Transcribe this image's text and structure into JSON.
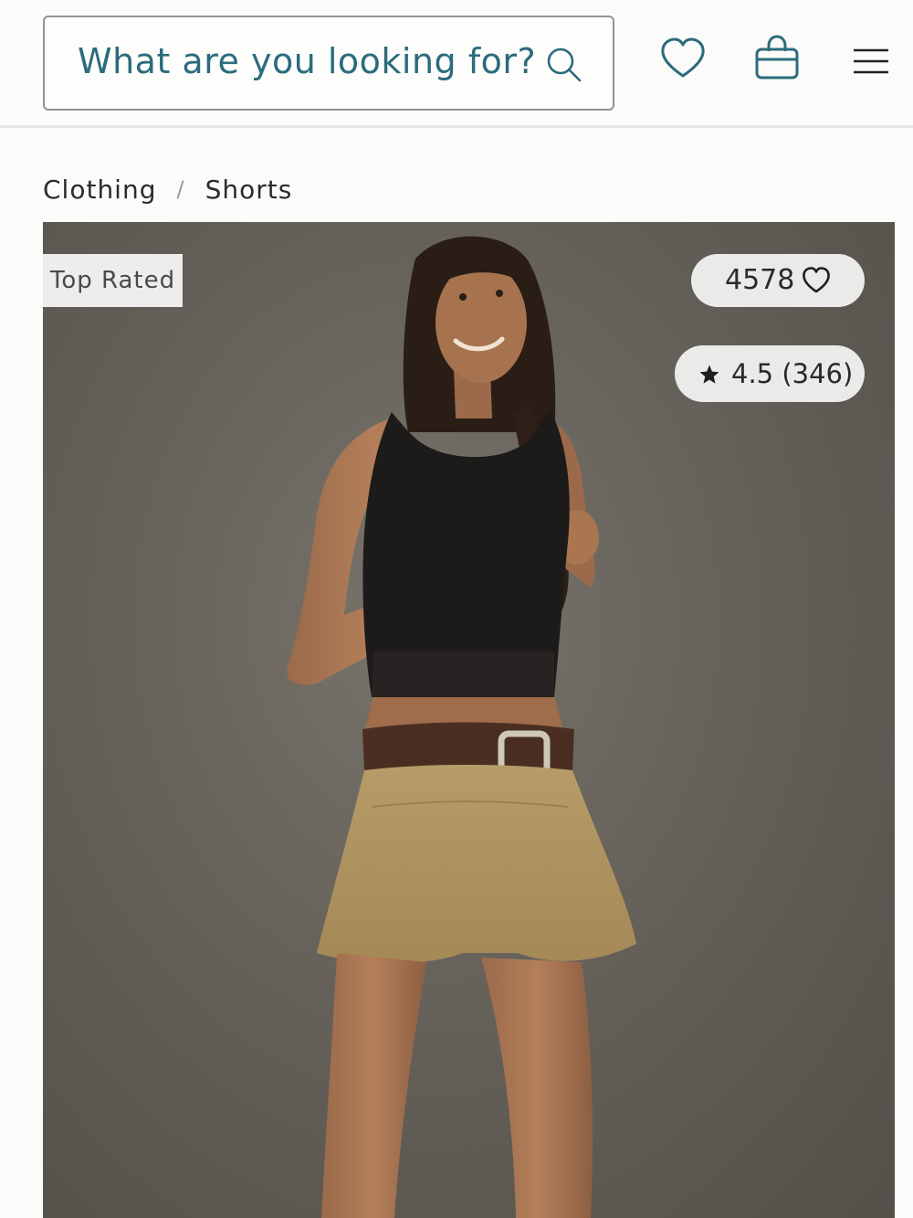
{
  "header": {
    "search": {
      "placeholder": "What are you looking for?",
      "icon": "search-icon"
    },
    "icons": [
      "heart-icon",
      "shopping-bag-icon",
      "hamburger-menu-icon"
    ],
    "accent_color": "#2b6c7c"
  },
  "breadcrumb": {
    "items": [
      "Clothing",
      "Shorts"
    ],
    "separator": "/"
  },
  "product": {
    "badge": "Top Rated",
    "likes": "4578",
    "rating": "4.5 (346)",
    "image": "model wearing black tank top, woven brown belt and khaki linen shorts"
  }
}
